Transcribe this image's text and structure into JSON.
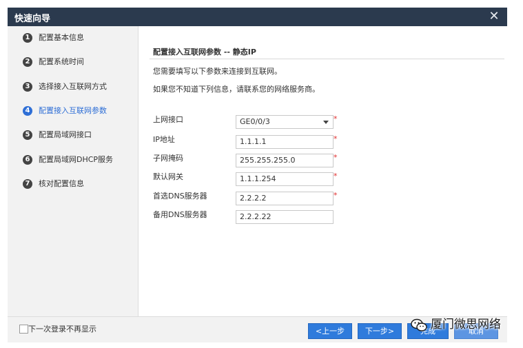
{
  "window": {
    "title": "快速向导",
    "close_glyph": "✕"
  },
  "steps": [
    {
      "num": "1",
      "label": "配置基本信息"
    },
    {
      "num": "2",
      "label": "配置系统时间"
    },
    {
      "num": "3",
      "label": "选择接入互联网方式"
    },
    {
      "num": "4",
      "label": "配置接入互联网参数"
    },
    {
      "num": "5",
      "label": "配置局域网接口"
    },
    {
      "num": "6",
      "label": "配置局域网DHCP服务"
    },
    {
      "num": "7",
      "label": "核对配置信息"
    }
  ],
  "active_step": 4,
  "main": {
    "heading": "配置接入互联网参数 -- 静态IP",
    "intro1": "您需要填写以下参数来连接到互联网。",
    "intro2": "如果您不知道下列信息，请联系您的网络服务商。",
    "required_mark": "*",
    "fields": {
      "interface": {
        "label": "上网接口",
        "value": "GE0/0/3"
      },
      "ip": {
        "label": "IP地址",
        "value": "1.1.1.1"
      },
      "mask": {
        "label": "子网掩码",
        "value": "255.255.255.0"
      },
      "gateway": {
        "label": "默认网关",
        "value": "1.1.1.254"
      },
      "dns1": {
        "label": "首选DNS服务器",
        "value": "2.2.2.2"
      },
      "dns2": {
        "label": "备用DNS服务器",
        "value": "2.2.2.22"
      }
    }
  },
  "footer": {
    "dont_show_label": "下一次登录不再显示",
    "prev_label": "<上一步",
    "next_label": "下一步>",
    "done_label": "完成",
    "cancel_label": "取消"
  },
  "watermark": {
    "text": "厦门微思网络",
    "icon": "wechat-icon"
  },
  "colors": {
    "titlebar": "#2b3a4e",
    "accent": "#2f7bdc",
    "active_step": "#2f6fd6",
    "required": "#e03030"
  }
}
